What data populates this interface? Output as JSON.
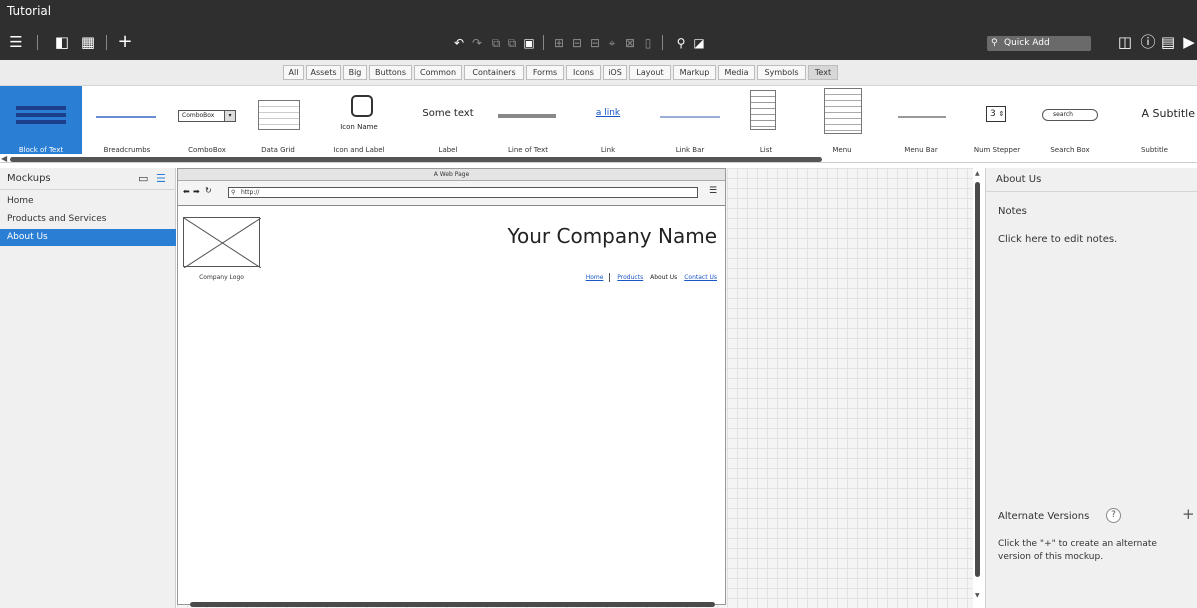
{
  "app": {
    "title": "Tutorial"
  },
  "toolbar": {
    "quick_add_placeholder": "Quick Add"
  },
  "filters": [
    "All",
    "Assets",
    "Big",
    "Buttons",
    "Common",
    "Containers",
    "Forms",
    "Icons",
    "iOS",
    "Layout",
    "Markup",
    "Media",
    "Symbols",
    "Text"
  ],
  "active_filter": "Text",
  "library": {
    "items": [
      {
        "label": "Block of Text",
        "selected": true
      },
      {
        "label": "Breadcrumbs"
      },
      {
        "label": "ComboBox",
        "preview": "ComboBox"
      },
      {
        "label": "Data Grid"
      },
      {
        "label": "Icon and Label",
        "preview": "Icon Name"
      },
      {
        "label": "Label",
        "preview": "Some text"
      },
      {
        "label": "Line of Text"
      },
      {
        "label": "Link",
        "preview": "a link"
      },
      {
        "label": "Link Bar"
      },
      {
        "label": "List"
      },
      {
        "label": "Menu"
      },
      {
        "label": "Menu Bar"
      },
      {
        "label": "Num Stepper",
        "preview": "3"
      },
      {
        "label": "Search Box",
        "preview": "search"
      },
      {
        "label": "Subtitle",
        "preview": "A Subtitle"
      }
    ]
  },
  "mockups": {
    "title": "Mockups",
    "items": [
      "Home",
      "Products and Services",
      "About Us"
    ],
    "selected": "About Us"
  },
  "browser": {
    "title": "A Web Page",
    "url": "http://",
    "company_name": "Your Company Name",
    "logo_caption": "Company Logo",
    "nav": [
      "Home",
      "Products",
      "About Us",
      "Contact Us"
    ]
  },
  "inspector": {
    "header": "About Us",
    "notes_label": "Notes",
    "notes_body": "Click here to edit notes.",
    "alt_label": "Alternate Versions",
    "alt_help": "?",
    "alt_add": "+",
    "alt_desc": "Click the \"+\" to create an alternate version of this mockup."
  },
  "colors": {
    "accent": "#2a7fd4",
    "titlebar": "#2f2f2f",
    "link": "#1a55c7"
  }
}
